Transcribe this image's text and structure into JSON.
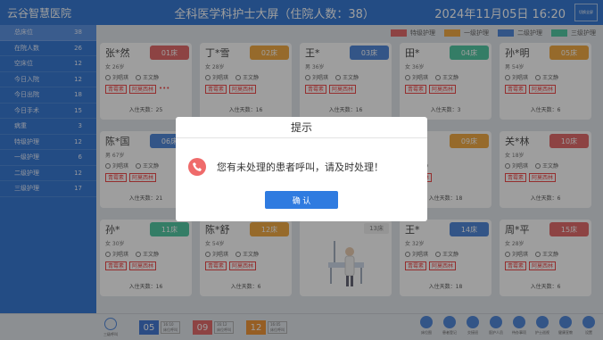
{
  "header": {
    "hospital": "云谷智慧医院",
    "title": "全科医学科护士大屏（住院人数：38）",
    "datetime": "2024年11月05日  16:20",
    "fullscreen_label": "切换全屏"
  },
  "sidebar": {
    "items": [
      {
        "label": "总床位",
        "count": "38"
      },
      {
        "label": "在院人数",
        "count": "26"
      },
      {
        "label": "空床位",
        "count": "12"
      },
      {
        "label": "今日入院",
        "count": "12"
      },
      {
        "label": "今日出院",
        "count": "18"
      },
      {
        "label": "今日手术",
        "count": "15"
      },
      {
        "label": "病重",
        "count": "3"
      },
      {
        "label": "特级护理",
        "count": "12"
      },
      {
        "label": "一级护理",
        "count": "6"
      },
      {
        "label": "二级护理",
        "count": "12"
      },
      {
        "label": "三级护理",
        "count": "17"
      }
    ]
  },
  "legend": [
    {
      "label": "特级护理",
      "color": "#e05a5a"
    },
    {
      "label": "一级护理",
      "color": "#f0a12e"
    },
    {
      "label": "二级护理",
      "color": "#3d7ad6"
    },
    {
      "label": "三级护理",
      "color": "#3fc39a"
    }
  ],
  "beds": [
    {
      "name": "张*然",
      "bed": "01床",
      "info": "女  26岁",
      "doctor": "刘唱琪",
      "nurse": "王文静",
      "tags": [
        "青霉素",
        "阿莫西林"
      ],
      "more": "•••",
      "days": "入住天数：25",
      "color": "#e05a5a"
    },
    {
      "name": "丁*雪",
      "bed": "02床",
      "info": "女  28岁",
      "doctor": "刘唱琪",
      "nurse": "王文静",
      "tags": [
        "青霉素",
        "阿莫西林"
      ],
      "days": "入住天数：16",
      "color": "#f0a12e"
    },
    {
      "name": "王*",
      "bed": "03床",
      "info": "男  36岁",
      "doctor": "刘唱琪",
      "nurse": "王文静",
      "tags": [
        "青霉素",
        "阿莫西林"
      ],
      "days": "入住天数：16",
      "color": "#3d7ad6"
    },
    {
      "name": "田*",
      "bed": "04床",
      "info": "女  36岁",
      "doctor": "刘唱琪",
      "nurse": "王文静",
      "tags": [
        "青霉素",
        "阿莫西林"
      ],
      "days": "入住天数：3",
      "color": "#3fc39a"
    },
    {
      "name": "孙*明",
      "bed": "05床",
      "info": "男  54岁",
      "doctor": "刘唱琪",
      "nurse": "王文静",
      "tags": [
        "青霉素",
        "阿莫西林"
      ],
      "days": "入住天数：6",
      "color": "#f0a12e"
    },
    {
      "name": "陈*国",
      "bed": "06床",
      "info": "男  67岁",
      "doctor": "刘唱琪",
      "nurse": "王文静",
      "tags": [
        "青霉素",
        "阿莫西林"
      ],
      "days": "入住天数：21",
      "color": "#3d7ad6"
    },
    {
      "name": "",
      "bed": "",
      "info": "",
      "doctor": "",
      "nurse": "",
      "tags": [],
      "days": "",
      "color": "#ffffff"
    },
    {
      "name": "",
      "bed": "",
      "info": "",
      "doctor": "",
      "nurse": "",
      "tags": [],
      "days": "",
      "color": "#ffffff"
    },
    {
      "name": "",
      "bed": "09床",
      "info": "",
      "doctor": "",
      "nurse": "王文静",
      "tags": [
        "阿莫西林"
      ],
      "days": "入住天数：18",
      "color": "#f0a12e"
    },
    {
      "name": "关*林",
      "bed": "10床",
      "info": "女  18岁",
      "doctor": "刘唱琪",
      "nurse": "王文静",
      "tags": [
        "青霉素",
        "阿莫西林"
      ],
      "days": "入住天数：6",
      "color": "#e05a5a"
    },
    {
      "name": "孙*",
      "bed": "11床",
      "info": "女  30岁",
      "doctor": "刘唱琪",
      "nurse": "王文静",
      "tags": [
        "青霉素",
        "阿莫西林"
      ],
      "days": "入住天数：16",
      "color": "#3fc39a"
    },
    {
      "name": "陈*舒",
      "bed": "12床",
      "info": "女  54岁",
      "doctor": "刘唱琪",
      "nurse": "王文静",
      "tags": [
        "青霉素",
        "阿莫西林"
      ],
      "days": "入住天数：6",
      "color": "#f0a12e"
    },
    {
      "name": "",
      "bed": "13床",
      "info": "",
      "doctor": "",
      "nurse": "",
      "tags": [],
      "days": "",
      "color": "#ffffff",
      "empty": true
    },
    {
      "name": "王*",
      "bed": "14床",
      "info": "女  32岁",
      "doctor": "刘唱琪",
      "nurse": "王文静",
      "tags": [
        "青霉素",
        "阿莫西林"
      ],
      "days": "入住天数：18",
      "color": "#3d7ad6"
    },
    {
      "name": "周*平",
      "bed": "15床",
      "info": "女  28岁",
      "doctor": "刘唱琪",
      "nurse": "王文静",
      "tags": [
        "青霉素",
        "阿莫西林"
      ],
      "days": "入住天数：6",
      "color": "#e05a5a"
    }
  ],
  "bottom": {
    "voice": "三级呼叫",
    "calls": [
      {
        "num": "05",
        "time": "16:10",
        "text": "床位呼叫",
        "color": "#2f6ad0"
      },
      {
        "num": "09",
        "time": "16:12",
        "text": "床位呼叫",
        "color": "#e05a5a"
      },
      {
        "num": "12",
        "time": "16:05",
        "text": "床位呼叫",
        "color": "#f08a22"
      }
    ],
    "tools": [
      "床位图",
      "患者登记",
      "交接班",
      "医护人员",
      "待办事项",
      "护士巡视",
      "健康宣教",
      "设置"
    ]
  },
  "dialog": {
    "title": "提示",
    "message": "您有未处理的患者呼叫，请及时处理！",
    "button": "确 认"
  }
}
